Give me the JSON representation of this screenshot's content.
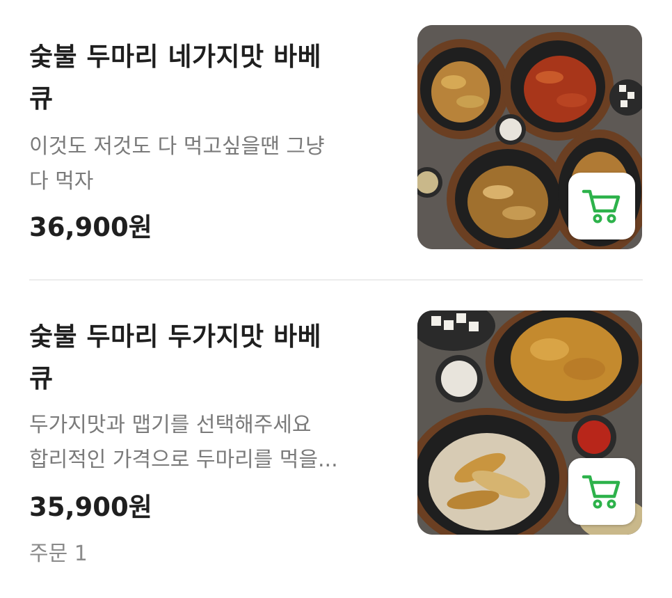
{
  "menu_items": [
    {
      "title_line1": "숯불 두마리 네가지맛 바베",
      "title_line2": "큐",
      "desc_line1": "이것도 저것도 다 먹고싶을땐 그냥",
      "desc_line2": "다 먹자",
      "price": "36,900원",
      "image_icon": "food-photo",
      "cart_icon": "shopping-cart-icon"
    },
    {
      "title_line1": "숯불 두마리 두가지맛 바베",
      "title_line2": "큐",
      "desc_line1": "두가지맛과 맵기를 선택해주세요",
      "desc_line2": "합리적인 가격으로 두마리를 먹을...",
      "price": "35,900원",
      "order_count": "주문 1",
      "image_icon": "food-photo",
      "cart_icon": "shopping-cart-icon"
    }
  ],
  "colors": {
    "accent": "#2db24b",
    "title": "#1f1f1f",
    "description": "#7a7a7a",
    "divider": "#ececec"
  }
}
